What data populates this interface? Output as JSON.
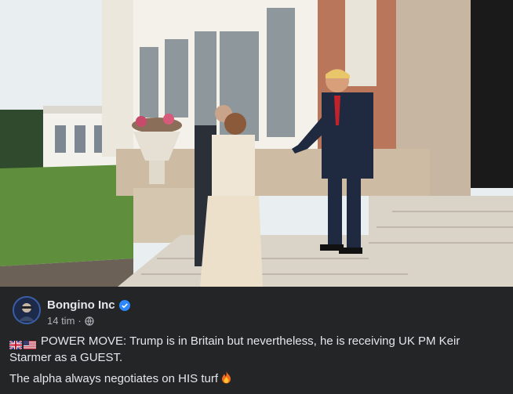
{
  "media": {
    "kind": "video-frame",
    "colors": {
      "sky": "#e9eef0",
      "building": "#f4f1ea",
      "brick": "#b9765a",
      "lawn": "#5f8f3d",
      "steps": "#d9d3c8",
      "suit": "#1f2940",
      "tie": "#c0232c"
    }
  },
  "post": {
    "author": "Bongino Inc",
    "verified_icon": "verified-badge-icon",
    "time": "14 tim",
    "separator": "·",
    "audience_icon": "globe-icon",
    "text_line1": "POWER MOVE: Trump is in Britain but nevertheless, he is receiving UK PM Keir Starmer as a GUEST.",
    "text_line2": "The alpha always negotiates on HIS turf",
    "flag_icons": [
      "uk-flag-icon",
      "us-flag-icon"
    ],
    "trailing_emoji": "fire-icon"
  },
  "colors": {
    "background": "#242526",
    "text": "#e4e6eb",
    "muted": "#b0b3b8",
    "verified": "#2d88ff"
  }
}
